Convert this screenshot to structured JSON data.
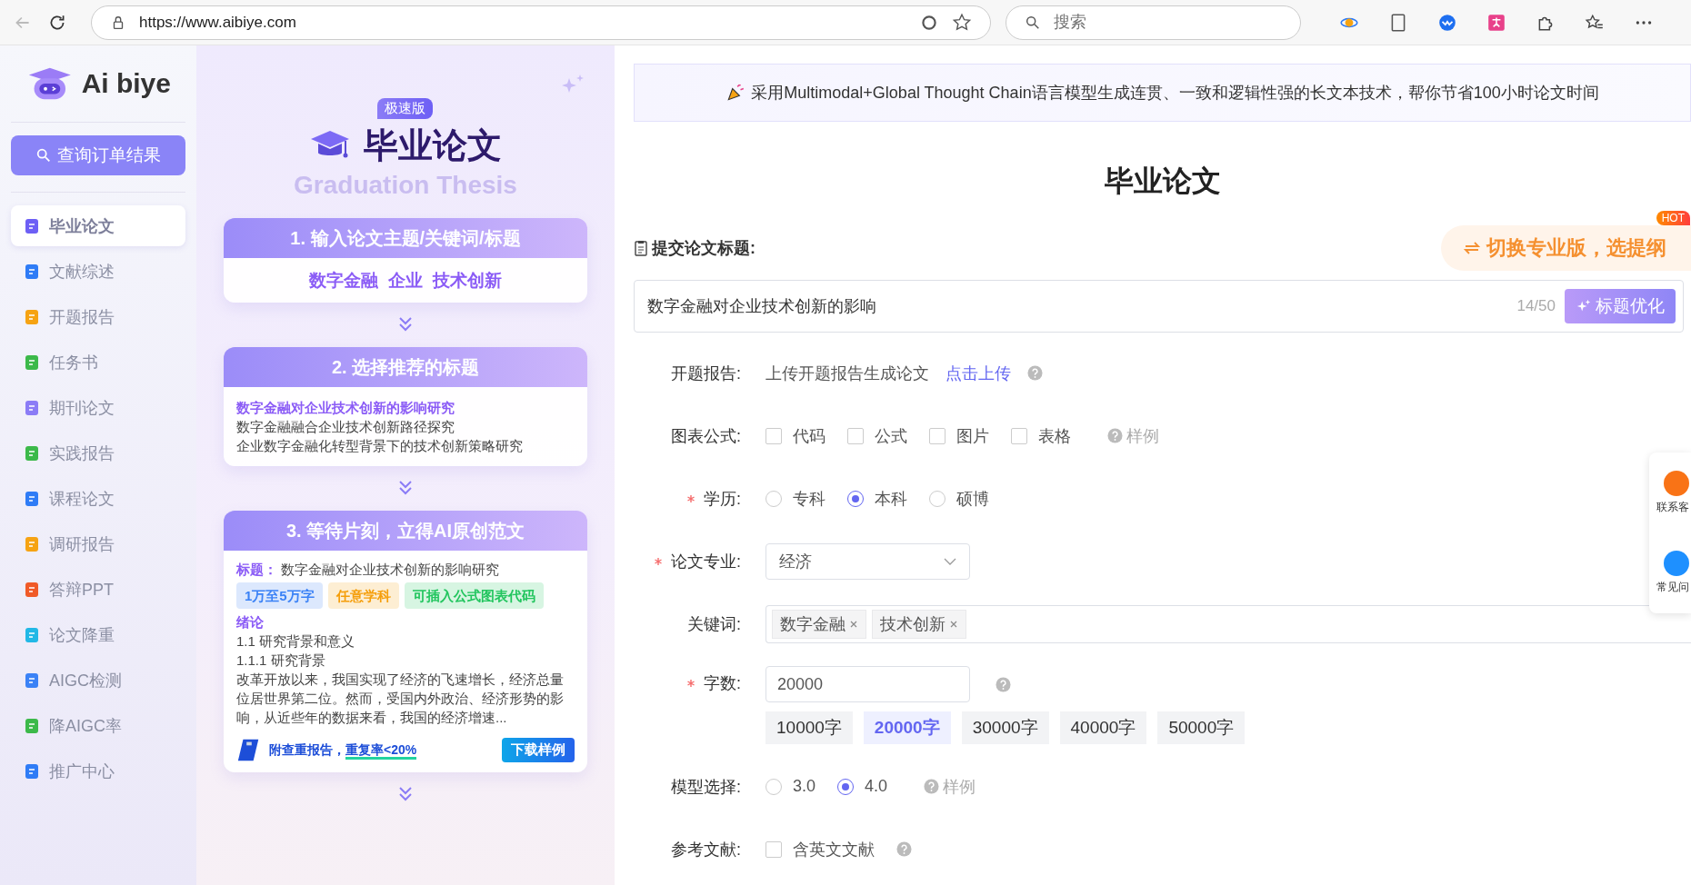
{
  "browser": {
    "url": "https://www.aibiye.com",
    "search_placeholder": "搜索"
  },
  "sidebar": {
    "logo": "Ai biye",
    "query_button": "查询订单结果",
    "items": [
      {
        "label": "毕业论文",
        "selected": true
      },
      {
        "label": "文献综述",
        "selected": false
      },
      {
        "label": "开题报告",
        "selected": false
      },
      {
        "label": "任务书",
        "selected": false
      },
      {
        "label": "期刊论文",
        "selected": false
      },
      {
        "label": "实践报告",
        "selected": false
      },
      {
        "label": "课程论文",
        "selected": false
      },
      {
        "label": "调研报告",
        "selected": false
      },
      {
        "label": "答辩PPT",
        "selected": false
      },
      {
        "label": "论文降重",
        "selected": false
      },
      {
        "label": "AIGC检测",
        "selected": false
      },
      {
        "label": "降AIGC率",
        "selected": false
      },
      {
        "label": "推广中心",
        "selected": false
      }
    ]
  },
  "promo": {
    "badge": "极速版",
    "title": "毕业论文",
    "subtitle": "Graduation Thesis",
    "step1": {
      "title": "1. 输入论文主题/关键词/标题",
      "content": "数字金融  企业  技术创新"
    },
    "step2": {
      "title": "2. 选择推荐的标题",
      "options": [
        {
          "text": "数字金融对企业技术创新的影响研究",
          "selected": true
        },
        {
          "text": "数字金融融合企业技术创新路径探究",
          "selected": false
        },
        {
          "text": "企业数字金融化转型背景下的技术创新策略研究",
          "selected": false
        }
      ]
    },
    "step3": {
      "title": "3. 等待片刻，立得AI原创范文",
      "title_label": "标题：",
      "title_value": "数字金融对企业技术创新的影响研究",
      "tags": [
        {
          "text": "1万至5万字",
          "color": "#3b82f6"
        },
        {
          "text": "任意学科",
          "color": "#f59e0b"
        },
        {
          "text": "可插入公式图表代码",
          "color": "#22c55e"
        }
      ],
      "heading": "绪论",
      "lines": [
        "1.1 研究背景和意义",
        "1.1.1 研究背景"
      ],
      "paragraph": "改革开放以来，我国实现了经济的飞速增长，经济总量位居世界第二位。然而，受国内外政治、经济形势的影响，从近些年的数据来看，我国的经济增速...",
      "footer_text": "附查重报告，",
      "footer_link": "重复率<20%",
      "button": "下载样例"
    }
  },
  "main": {
    "banner": "采用Multimodal+Global Thought Chain语言模型生成连贯、一致和逻辑性强的长文本技术，帮你节省100小时论文时间",
    "heading": "毕业论文",
    "title_label": "提交论文标题:",
    "pro_switch": {
      "text": "切换专业版，选提纲",
      "badge": "HOT"
    },
    "title_input": {
      "value": "数字金融对企业技术创新的影响",
      "counter": "14/50",
      "button": "标题优化"
    },
    "rows": [
      {
        "kind": "upload",
        "label": "开题报告:",
        "required": false,
        "text": "上传开题报告生成论文",
        "link": "点击上传"
      },
      {
        "kind": "checks",
        "label": "图表公式:",
        "required": false,
        "options": [
          {
            "label": "代码",
            "checked": false
          },
          {
            "label": "公式",
            "checked": false
          },
          {
            "label": "图片",
            "checked": false
          },
          {
            "label": "表格",
            "checked": false
          }
        ],
        "sample": "样例"
      },
      {
        "kind": "radios",
        "label": "学历:",
        "required": true,
        "options": [
          {
            "label": "专科",
            "selected": false
          },
          {
            "label": "本科",
            "selected": true
          },
          {
            "label": "硕博",
            "selected": false
          }
        ]
      },
      {
        "kind": "select",
        "label": "论文专业:",
        "required": true,
        "value": "经济"
      },
      {
        "kind": "tags",
        "label": "关键词:",
        "required": false,
        "tags": [
          "数字金融",
          "技术创新"
        ]
      },
      {
        "kind": "number",
        "label": "字数:",
        "required": true,
        "value": "20000",
        "chips": [
          {
            "label": "10000字",
            "selected": false
          },
          {
            "label": "20000字",
            "selected": true
          },
          {
            "label": "30000字",
            "selected": false
          },
          {
            "label": "40000字",
            "selected": false
          },
          {
            "label": "50000字",
            "selected": false
          }
        ]
      },
      {
        "kind": "radios",
        "label": "模型选择:",
        "required": false,
        "options": [
          {
            "label": "3.0",
            "selected": false
          },
          {
            "label": "4.0",
            "selected": true
          }
        ],
        "sample": "样例"
      },
      {
        "kind": "checks",
        "label": "参考文献:",
        "required": false,
        "options": [
          {
            "label": "含英文文献",
            "checked": false
          }
        ]
      }
    ]
  },
  "float_panel": [
    "联系客",
    "常见问"
  ]
}
